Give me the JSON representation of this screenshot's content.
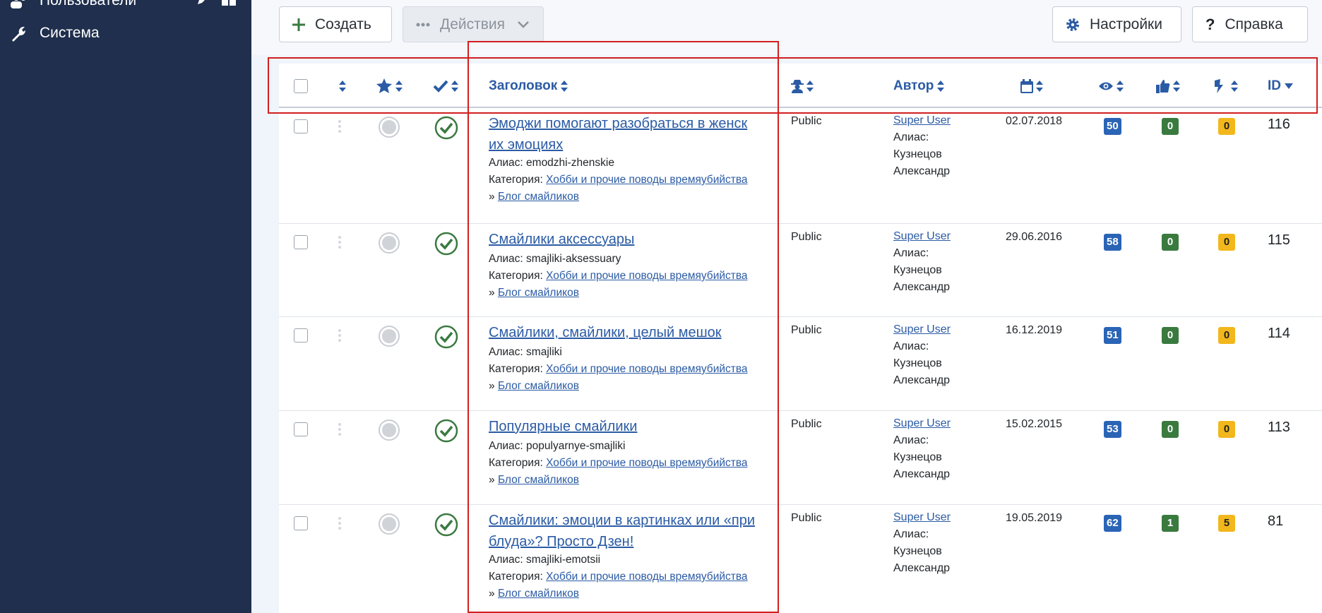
{
  "sidebar": {
    "users_label": "Пользователи",
    "system_label": "Система"
  },
  "toolbar": {
    "create_label": "Создать",
    "actions_label": "Действия",
    "settings_label": "Настройки",
    "help_label": "Справка"
  },
  "table": {
    "headers": {
      "title": "Заголовок",
      "author": "Автор",
      "id": "ID"
    },
    "rows": [
      {
        "title_lines": [
          "Эмоджи помогают разобраться в женск",
          "их эмоциях"
        ],
        "alias_label": "Алиас:",
        "alias": "emodzhi-zhenskie",
        "category_label": "Категория:",
        "category": "Хобби и прочие поводы времяубийства",
        "subcategory_prefix": "»",
        "subcategory": "Блог смайликов",
        "access": "Public",
        "author": "Super User",
        "author_alias_label": "Алиас:",
        "author_alias_1": "Кузнецов",
        "author_alias_2": "Александр",
        "date": "02.07.2018",
        "hits": "50",
        "up": "0",
        "down": "0",
        "id": "116"
      },
      {
        "title_lines": [
          "Смайлики аксессуары",
          ""
        ],
        "alias_label": "Алиас:",
        "alias": "smajliki-aksessuary",
        "category_label": "Категория:",
        "category": "Хобби и прочие поводы времяубийства",
        "subcategory_prefix": "»",
        "subcategory": "Блог смайликов",
        "access": "Public",
        "author": "Super User",
        "author_alias_label": "Алиас:",
        "author_alias_1": "Кузнецов",
        "author_alias_2": "Александр",
        "date": "29.06.2016",
        "hits": "58",
        "up": "0",
        "down": "0",
        "id": "115"
      },
      {
        "title_lines": [
          "Смайлики, смайлики, целый мешок",
          ""
        ],
        "alias_label": "Алиас:",
        "alias": "smajliki",
        "category_label": "Категория:",
        "category": "Хобби и прочие поводы времяубийства",
        "subcategory_prefix": "»",
        "subcategory": "Блог смайликов",
        "access": "Public",
        "author": "Super User",
        "author_alias_label": "Алиас:",
        "author_alias_1": "Кузнецов",
        "author_alias_2": "Александр",
        "date": "16.12.2019",
        "hits": "51",
        "up": "0",
        "down": "0",
        "id": "114"
      },
      {
        "title_lines": [
          "Популярные смайлики",
          ""
        ],
        "alias_label": "Алиас:",
        "alias": "populyarnye-smajliki",
        "category_label": "Категория:",
        "category": "Хобби и прочие поводы времяубийства",
        "subcategory_prefix": "»",
        "subcategory": "Блог смайликов",
        "access": "Public",
        "author": "Super User",
        "author_alias_label": "Алиас:",
        "author_alias_1": "Кузнецов",
        "author_alias_2": "Александр",
        "date": "15.02.2015",
        "hits": "53",
        "up": "0",
        "down": "0",
        "id": "113"
      },
      {
        "title_lines": [
          "Смайлики: эмоции в картинках или «при",
          "блуда»? Просто Дзен!"
        ],
        "alias_label": "Алиас:",
        "alias": "smajliki-emotsii",
        "category_label": "Категория:",
        "category": "Хобби и прочие поводы времяубийства",
        "subcategory_prefix": "»",
        "subcategory": "Блог смайликов",
        "access": "Public",
        "author": "Super User",
        "author_alias_label": "Алиас:",
        "author_alias_1": "Кузнецов",
        "author_alias_2": "Александр",
        "date": "19.05.2019",
        "hits": "62",
        "up": "1",
        "down": "5",
        "id": "81"
      }
    ]
  },
  "colors": {
    "sidebar_bg": "#1f2f4d",
    "link": "#2b5ba5",
    "hits_badge": "#2a64b5",
    "up_badge": "#3a7a3f",
    "down_badge": "#f2b71c",
    "highlight": "#d11f1f",
    "published": "#3a7a3f"
  },
  "icons": {
    "create": "plus-icon",
    "actions": "ellipsis-icon",
    "settings": "gear-icon",
    "help": "question-icon",
    "system": "wrench-icon",
    "featured": "star-icon",
    "status": "check-icon",
    "access": "user-secret-icon",
    "date": "calendar-icon",
    "hits": "eye-icon",
    "up": "thumbs-up-icon",
    "down": "thumbs-down-icon"
  }
}
